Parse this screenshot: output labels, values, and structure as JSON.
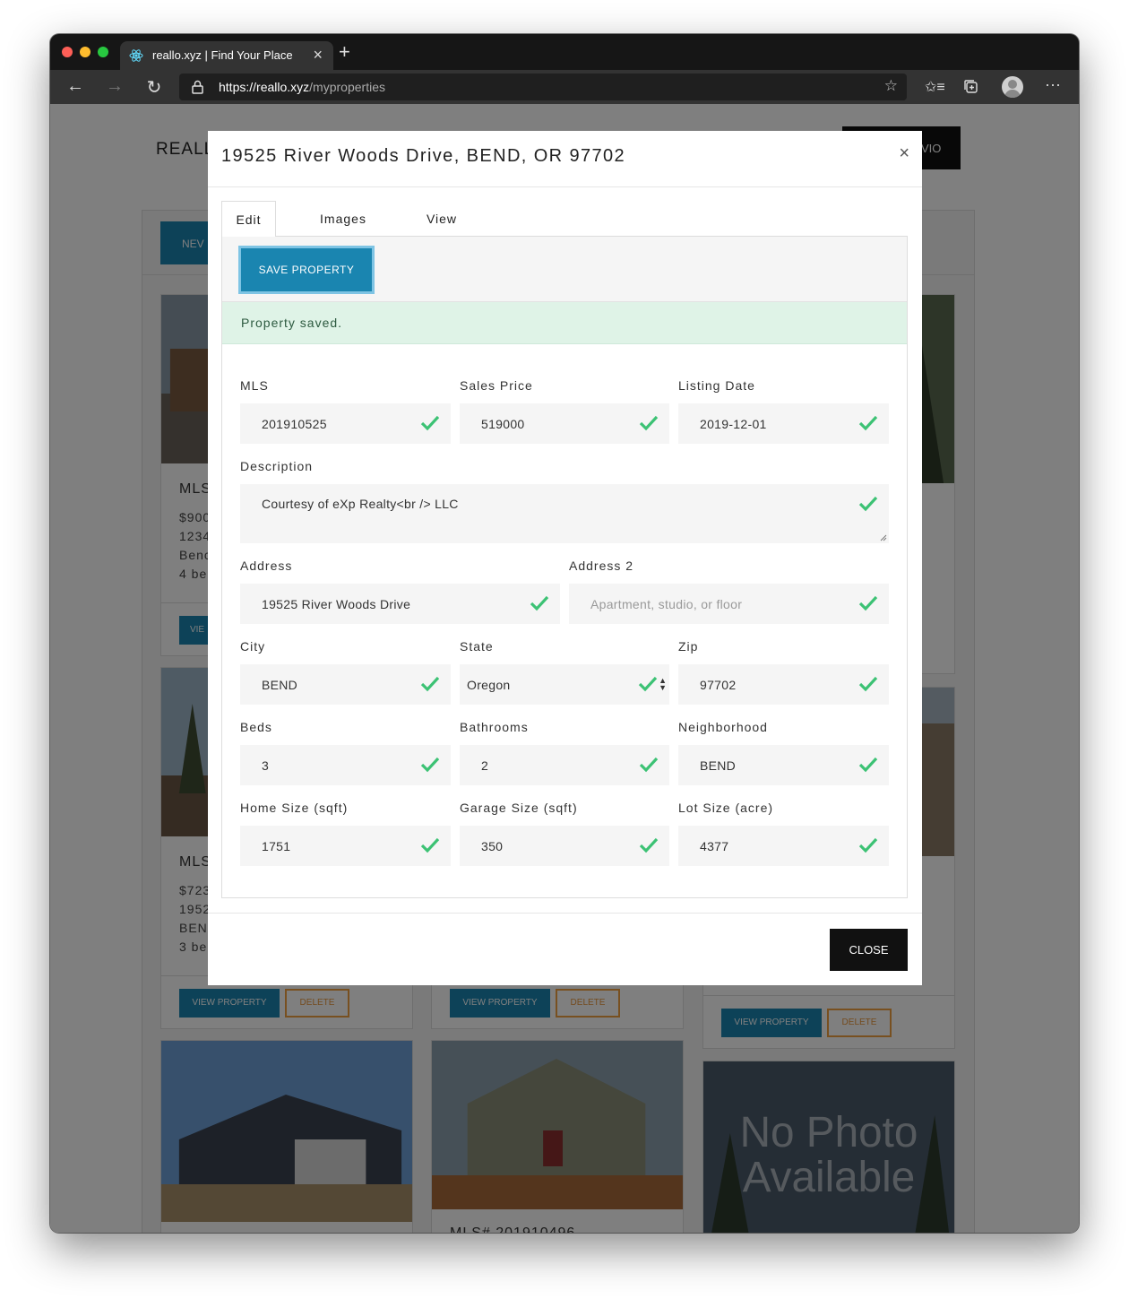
{
  "browser": {
    "tab_title": "reallo.xyz | Find Your Place",
    "url_scheme": "https://",
    "url_host": "reallo.xyz",
    "url_path": "/myproperties"
  },
  "background": {
    "brand": "REALL",
    "nav_button_fragment": "VIO",
    "new_button_fragment": "NEV",
    "cards": [
      {
        "mls": "MLS",
        "lines": [
          "$900",
          "1234",
          "Benc",
          "4 be"
        ],
        "view_fragment": "VIE"
      },
      {
        "mls": "MLS",
        "lines": [
          "$723",
          "1952",
          "BEN",
          "3 be"
        ],
        "view_label": "VIEW PROPERTY",
        "delete_label": "DELETE"
      },
      {
        "view_label": "VIEW PROPERTY",
        "delete_label": "DELETE"
      },
      {
        "view_label": "VIEW PROPERTY",
        "delete_label": "DELETE"
      },
      {
        "mls_partial": "MLS# 201910496"
      },
      {
        "photo_text_1": "No Photo",
        "photo_text_2": "Available"
      }
    ]
  },
  "modal": {
    "title": "19525 River Woods Drive, BEND, OR 97702",
    "tabs": [
      "Edit",
      "Images",
      "View"
    ],
    "save_label": "SAVE PROPERTY",
    "alert": "Property saved.",
    "close_label": "CLOSE",
    "fields": {
      "mls": {
        "label": "MLS",
        "value": "201910525"
      },
      "sales_price": {
        "label": "Sales Price",
        "value": "519000"
      },
      "listing_date": {
        "label": "Listing Date",
        "value": "2019-12-01"
      },
      "description": {
        "label": "Description",
        "value": "Courtesy of eXp Realty<br /> LLC"
      },
      "address": {
        "label": "Address",
        "value": "19525 River Woods Drive"
      },
      "address2": {
        "label": "Address 2",
        "value": "",
        "placeholder": "Apartment, studio, or floor"
      },
      "city": {
        "label": "City",
        "value": "BEND"
      },
      "state": {
        "label": "State",
        "value": "Oregon"
      },
      "zip": {
        "label": "Zip",
        "value": "97702"
      },
      "beds": {
        "label": "Beds",
        "value": "3"
      },
      "bathrooms": {
        "label": "Bathrooms",
        "value": "2"
      },
      "neighborhood": {
        "label": "Neighborhood",
        "value": "BEND"
      },
      "home_size": {
        "label": "Home Size (sqft)",
        "value": "1751"
      },
      "garage_size": {
        "label": "Garage Size (sqft)",
        "value": "350"
      },
      "lot_size": {
        "label": "Lot Size (acre)",
        "value": "4377"
      }
    }
  },
  "colors": {
    "primary": "#1a85b0",
    "success_check": "#3cc274",
    "alert_bg": "#dff3e7",
    "delete_outline": "#f0a040"
  }
}
